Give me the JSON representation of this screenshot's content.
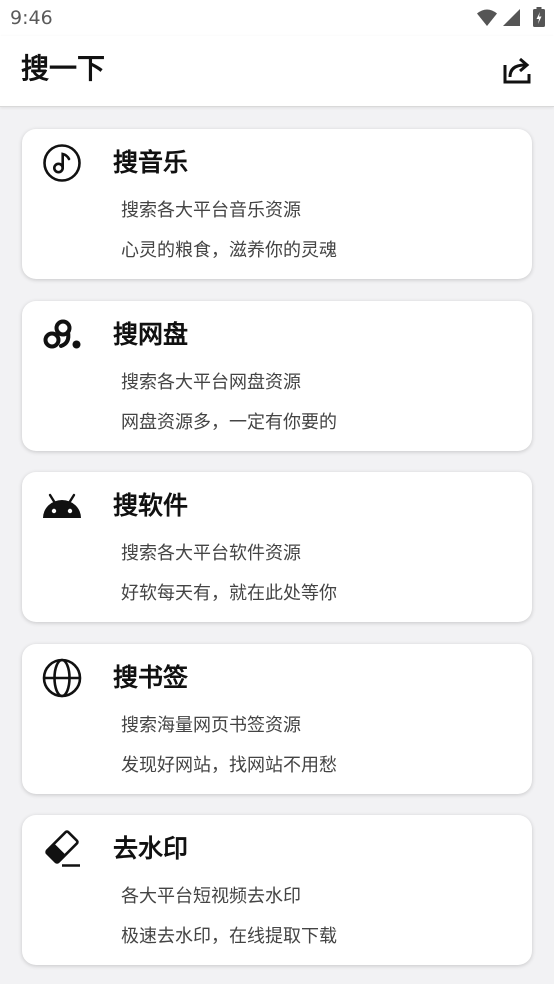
{
  "status_bar": {
    "time": "9:46",
    "icons": [
      "wifi-icon",
      "signal-icon",
      "battery-charging-icon"
    ]
  },
  "app_bar": {
    "title": "搜一下",
    "action_icon": "share-icon"
  },
  "cards": [
    {
      "icon": "music-disc-icon",
      "title": "搜音乐",
      "lines": [
        "搜索各大平台音乐资源",
        "心灵的粮食，滋养你的灵魂"
      ]
    },
    {
      "icon": "cloud-drive-icon",
      "title": "搜网盘",
      "lines": [
        "搜索各大平台网盘资源",
        "网盘资源多，一定有你要的"
      ]
    },
    {
      "icon": "android-icon",
      "title": "搜软件",
      "lines": [
        "搜索各大平台软件资源",
        "好软每天有，就在此处等你"
      ]
    },
    {
      "icon": "globe-icon",
      "title": "搜书签",
      "lines": [
        "搜索海量网页书签资源",
        "发现好网站，找网站不用愁"
      ]
    },
    {
      "icon": "eraser-icon",
      "title": "去水印",
      "lines": [
        "各大平台短视频去水印",
        "极速去水印，在线提取下载"
      ]
    }
  ],
  "colors": {
    "page_background": "#f2f2f4",
    "surface": "#ffffff",
    "text_primary": "#111111",
    "text_secondary": "#444444",
    "status_icons": "#555555"
  }
}
